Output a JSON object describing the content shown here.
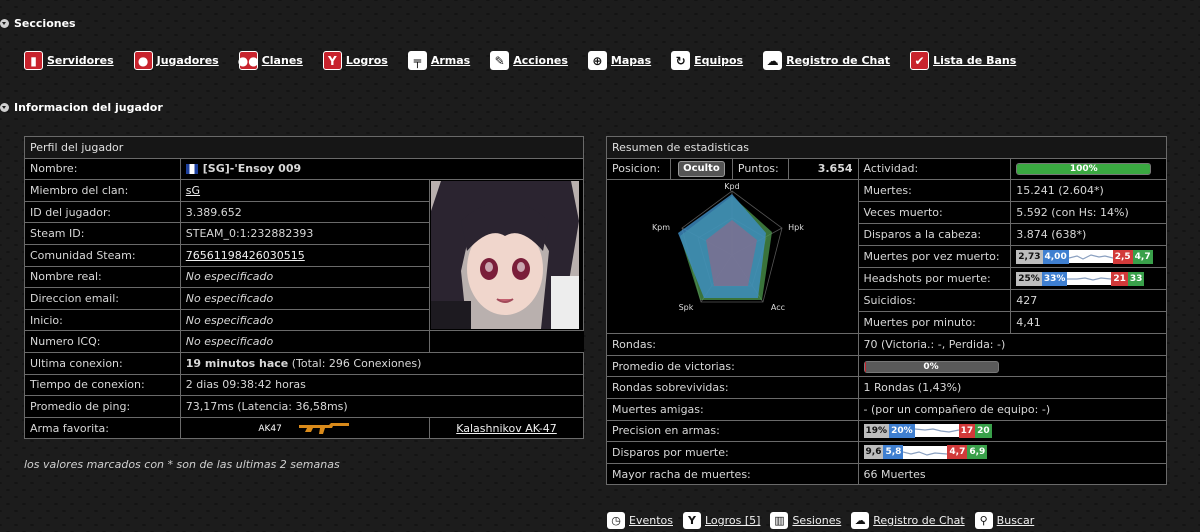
{
  "sections": {
    "title": "Secciones"
  },
  "nav": [
    {
      "label": "Servidores",
      "icon": "server-icon"
    },
    {
      "label": "Jugadores",
      "icon": "player-icon"
    },
    {
      "label": "Clanes",
      "icon": "clan-icon"
    },
    {
      "label": "Logros",
      "icon": "trophy-icon"
    },
    {
      "label": "Armas",
      "icon": "weapon-icon"
    },
    {
      "label": "Acciones",
      "icon": "wrench-icon"
    },
    {
      "label": "Mapas",
      "icon": "crosshair-icon"
    },
    {
      "label": "Equipos",
      "icon": "refresh-icon"
    },
    {
      "label": "Registro de Chat",
      "icon": "chat-icon"
    },
    {
      "label": "Lista de Bans",
      "icon": "ban-check-icon"
    }
  ],
  "player_info": {
    "title": "Informacion del jugador"
  },
  "profile": {
    "title": "Perfil del jugador",
    "rows": {
      "name": {
        "label": "Nombre:",
        "value": "[SG]-'Ensoy 009"
      },
      "clan": {
        "label": "Miembro del clan:",
        "value": "sG"
      },
      "id": {
        "label": "ID del jugador:",
        "value": "3.389.652"
      },
      "steam_id": {
        "label": "Steam ID:",
        "value": "STEAM_0:1:232882393"
      },
      "community": {
        "label": "Comunidad Steam:",
        "value": "76561198426030515"
      },
      "real_name": {
        "label": "Nombre real:",
        "value": "No especificado"
      },
      "email": {
        "label": "Direccion email:",
        "value": "No especificado"
      },
      "home": {
        "label": "Inicio:",
        "value": "No especificado"
      },
      "icq": {
        "label": "Numero ICQ:",
        "value": "No especificado"
      },
      "last_conn": {
        "label": "Ultima conexion:",
        "value_bold": "19 minutos hace",
        "value_rest": "(Total: 296 Conexiones)"
      },
      "conn_time": {
        "label": "Tiempo de conexion:",
        "value": "2 dias 09:38:42 horas"
      },
      "ping": {
        "label": "Promedio de ping:",
        "value": "73,17ms (Latencia: 36,58ms)"
      },
      "weapon": {
        "label": "Arma favorita:",
        "code": "AK47",
        "name": "Kalashnikov AK-47"
      }
    }
  },
  "note": "los valores marcados con * son de las ultimas 2 semanas",
  "stats": {
    "title": "Resumen de estadisticas",
    "position_label": "Posicion:",
    "position_value": "Oculto",
    "points_label": "Puntos:",
    "points_value": "3.654",
    "activity_label": "Actividad:",
    "activity_value": "100%",
    "activity_fraction": 1.0,
    "radar_labels": {
      "kpd": "Kpd",
      "hpk": "Hpk",
      "acc": "Acc",
      "spk": "Spk",
      "kpm": "Kpm"
    },
    "kills": {
      "label": "Muertes:",
      "value": "15.241 (2.604*)"
    },
    "deaths": {
      "label": "Veces muerto:",
      "value": "5.592 (con Hs: 14%)"
    },
    "headshots": {
      "label": "Disparos a la cabeza:",
      "value": "3.874 (638*)"
    },
    "kpd": {
      "label": "Muertes por vez muerto:",
      "t1": "2,73",
      "t2": "4,00",
      "t3": "2,5",
      "t4": "4,7"
    },
    "hpk": {
      "label": "Headshots por muerte:",
      "t1": "25%",
      "t2": "33%",
      "t3": "21",
      "t4": "33"
    },
    "suicides": {
      "label": "Suicidios:",
      "value": "427"
    },
    "kpm": {
      "label": "Muertes por minuto:",
      "value": "4,41"
    },
    "rounds": {
      "label": "Rondas:",
      "value": "70 (Victoria.: -, Perdida: -)"
    },
    "win_avg": {
      "label": "Promedio de victorias:",
      "value": "0%",
      "fraction": 0.0
    },
    "survived": {
      "label": "Rondas sobrevividas:",
      "value": "1 Rondas (1,43%)"
    },
    "tk": {
      "label": "Muertes amigas:",
      "value": "- (por un compañero de equipo: -)"
    },
    "accuracy": {
      "label": "Precision en armas:",
      "t1": "19%",
      "t2": "20%",
      "t3": "17",
      "t4": "20"
    },
    "spk": {
      "label": "Disparos por muerte:",
      "t1": "9,6",
      "t2": "5,8",
      "t3": "4,7",
      "t4": "6,9"
    },
    "streak": {
      "label": "Mayor racha de muertes:",
      "value": "66 Muertes"
    }
  },
  "footer": [
    {
      "label": "Eventos",
      "icon": "clock-icon"
    },
    {
      "label": "Logros [5]",
      "icon": "trophy-icon"
    },
    {
      "label": "Sesiones",
      "icon": "bars-icon"
    },
    {
      "label": "Registro de Chat",
      "icon": "chat-icon"
    },
    {
      "label": "Buscar",
      "icon": "magnifier-icon"
    }
  ],
  "colors": {
    "accent_red": "#c8232d",
    "bar_green": "#3aa841",
    "radar_blue": "#3f8fc7",
    "radar_green": "#4e9a4e"
  }
}
